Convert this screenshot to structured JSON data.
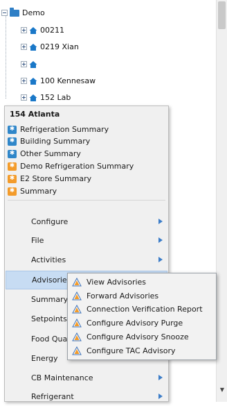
{
  "tree": {
    "root_label": "Demo",
    "items": [
      {
        "label": "00211"
      },
      {
        "label": "0219 Xian"
      },
      {
        "label": ""
      },
      {
        "label": "100 Kennesaw"
      },
      {
        "label": "152 Lab"
      }
    ]
  },
  "menu": {
    "title": "154 Atlanta",
    "quick_items": [
      {
        "label": "Refrigeration Summary",
        "color": "blue"
      },
      {
        "label": "Building Summary",
        "color": "blue"
      },
      {
        "label": "Other Summary",
        "color": "blue"
      },
      {
        "label": "Demo Refrigeration Summary",
        "color": "orange"
      },
      {
        "label": "E2 Store Summary",
        "color": "orange"
      },
      {
        "label": "Summary",
        "color": "orange"
      }
    ],
    "items": [
      {
        "label": "Configure"
      },
      {
        "label": "File"
      },
      {
        "label": "Activities"
      },
      {
        "label": "Advisories"
      },
      {
        "label": "Summary"
      },
      {
        "label": "Setpoints"
      },
      {
        "label": "Food Quality"
      },
      {
        "label": "Energy"
      },
      {
        "label": "CB Maintenance"
      },
      {
        "label": "Refrigerant"
      }
    ]
  },
  "submenu": {
    "items": [
      {
        "label": "View Advisories"
      },
      {
        "label": "Forward Advisories"
      },
      {
        "label": "Connection Verification Report"
      },
      {
        "label": "Configure Advisory Purge"
      },
      {
        "label": "Configure Advisory Snooze"
      },
      {
        "label": "Configure TAC Advisory"
      }
    ]
  },
  "colors": {
    "menu_bg": "#f0f0f0",
    "highlight": "#c7dcf3",
    "arrow": "#3c7dc8",
    "folder_blue": "#2f7fc6",
    "warning_orange": "#f39b2a"
  }
}
